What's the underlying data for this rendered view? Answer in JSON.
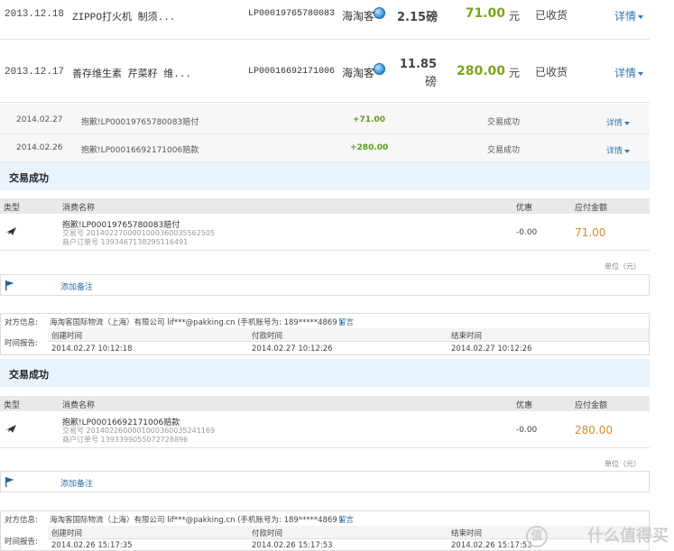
{
  "orders": [
    {
      "date": "2013.12.18",
      "name": "ZIPPO打火机 制须...",
      "order_no": "LP00019765780083",
      "shop": "海淘客",
      "weight": "2.15磅",
      "weight_line1": "2.15磅",
      "weight_line2": "",
      "price": "71.00",
      "unit": "元",
      "status": "已收货",
      "detail": "详情"
    },
    {
      "date": "2013.12.17",
      "name": "善存维生素 芹菜籽 维...",
      "order_no": "LP00016692171006",
      "shop": "海淘客",
      "weight_line1": "11.85",
      "weight_line2": "磅",
      "price": "280.00",
      "unit": "元",
      "status": "已收货",
      "detail": "详情"
    }
  ],
  "refunds": [
    {
      "date": "2014.02.27",
      "desc": "抱歉!LP00019765780083赔付",
      "amount": "+71.00",
      "status": "交易成功",
      "detail": "详情"
    },
    {
      "date": "2014.02.26",
      "desc": "抱歉!LP00016692171006赔款",
      "amount": "+280.00",
      "status": "交易成功",
      "detail": "详情"
    }
  ],
  "transactions": [
    {
      "status": "交易成功",
      "headers": {
        "type": "类型",
        "name": "消费名称",
        "discount": "优惠",
        "payable": "应付金额"
      },
      "title": "抱歉!LP00019765780083赔付",
      "trade_no": "交易号 2014022700001000360035562505",
      "merchant_no": "商户订单号 1393467138295116491",
      "discount": "-0.00",
      "payable": "71.00",
      "unit_note": "单位（元）",
      "remark": "添加备注",
      "counterparty_label": "对方信息:",
      "counterparty": "海淘客国际物流（上海）有限公司 lif***@pakking.cn (手机账号为: 189*****4869 )",
      "message_link": "留言",
      "time_label": "时间报告:",
      "time_headers": [
        "创建时间",
        "付款时间",
        "结束时间"
      ],
      "times": [
        "2014.02.27 10:12:18",
        "2014.02.27 10:12:26",
        "2014.02.27 10:12:26"
      ]
    },
    {
      "status": "交易成功",
      "headers": {
        "type": "类型",
        "name": "消费名称",
        "discount": "优惠",
        "payable": "应付金额"
      },
      "title": "抱歉!LP00016692171006赔款",
      "trade_no": "交易号 2014022600001000360035241169",
      "merchant_no": "商户订单号 1393399055072728896",
      "discount": "-0.00",
      "payable": "280.00",
      "unit_note": "单位（元）",
      "remark": "添加备注",
      "counterparty_label": "对方信息:",
      "counterparty": "海淘客国际物流（上海）有限公司 lif***@pakking.cn (手机账号为: 189*****4869 )",
      "message_link": "留言",
      "time_label": "时间报告:",
      "time_headers": [
        "创建时间",
        "付款时间",
        "结束时间"
      ],
      "times": [
        "2014.02.26 15:17:35",
        "2014.02.26 15:17:53",
        "2014.02.26 15:17:53"
      ]
    }
  ],
  "watermark": {
    "glyph": "值",
    "text": "什么值得买"
  }
}
